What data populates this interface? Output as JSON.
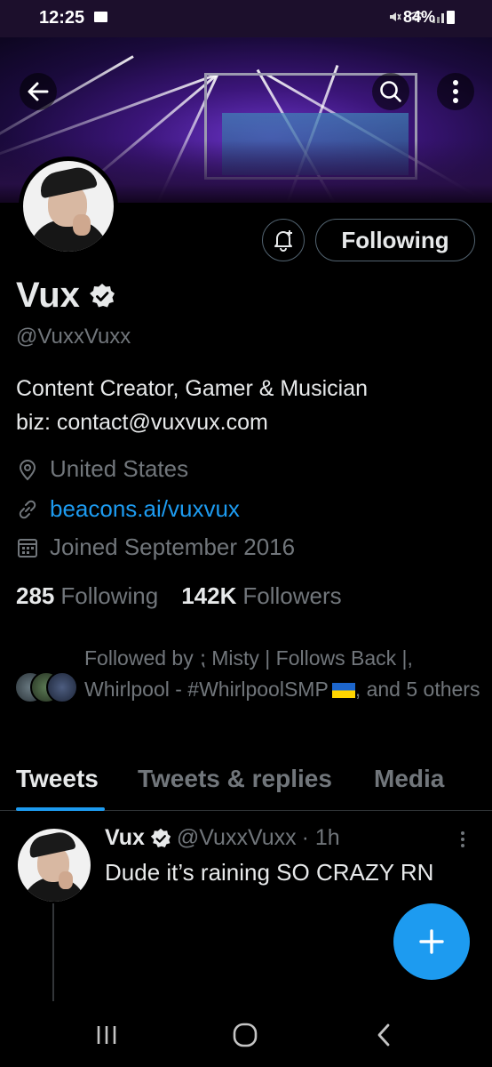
{
  "status_bar": {
    "time": "12:25",
    "battery": "84%",
    "icons": [
      "folder-icon",
      "mute-icon",
      "wifi-icon",
      "signal-icon",
      "battery-icon"
    ]
  },
  "banner": {
    "back_icon": "arrow-left-icon",
    "search_icon": "search-icon",
    "more_icon": "more-vertical-icon"
  },
  "actions": {
    "notify_icon": "bell-plus-icon",
    "follow_label": "Following"
  },
  "profile": {
    "display_name": "Vux",
    "verified": true,
    "handle": "@VuxxVuxx",
    "bio_line1": "Content Creator, Gamer & Musician",
    "bio_line2": "biz: contact@vuxvux.com",
    "location": "United States",
    "link": "beacons.ai/vuxvux",
    "joined": "Joined September 2016",
    "following_count": "285",
    "following_label": "Following",
    "followers_count": "142K",
    "followers_label": "Followers"
  },
  "followed_by": {
    "text_part1": "Followed by ⁏ Misty | Follows Back |, Whirlpool - #WhirlpoolSMP",
    "text_part2": ", and 5 others"
  },
  "tabs": [
    {
      "label": "Tweets",
      "active": true
    },
    {
      "label": "Tweets & replies",
      "active": false
    },
    {
      "label": "Media",
      "active": false
    }
  ],
  "tweet": {
    "name": "Vux",
    "handle": "@VuxxVuxx",
    "time": "· 1h",
    "text": "Dude it’s raining SO CRAZY RN"
  },
  "colors": {
    "accent": "#1d9bf0",
    "background": "#000000",
    "secondary_text": "#71767b",
    "primary_text": "#e7e9ea"
  }
}
